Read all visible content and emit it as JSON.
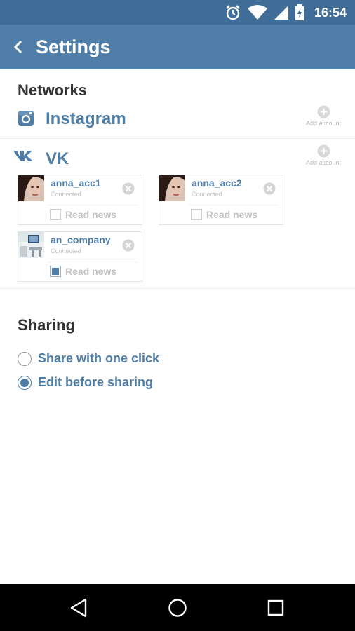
{
  "status_bar": {
    "time": "16:54",
    "icons": [
      "alarm-icon",
      "wifi-icon",
      "signal-icon",
      "battery-icon"
    ]
  },
  "app_bar": {
    "title": "Settings",
    "back_icon": "chevron-left-icon"
  },
  "networks": {
    "title": "Networks",
    "items": [
      {
        "name": "Instagram",
        "icon": "instagram-icon",
        "add_label": "Add account"
      },
      {
        "name": "VK",
        "icon": "vk-icon",
        "add_label": "Add account"
      }
    ],
    "accounts": [
      {
        "name": "anna_acc1",
        "status": "Connected",
        "read_news": "Read news",
        "read_news_checked": false
      },
      {
        "name": "anna_acc2",
        "status": "Connected",
        "read_news": "Read news",
        "read_news_checked": false
      },
      {
        "name": "an_company",
        "status": "Connected",
        "read_news": "Read news",
        "read_news_checked": true
      }
    ]
  },
  "sharing": {
    "title": "Sharing",
    "options": [
      {
        "label": "Share with one click",
        "selected": false
      },
      {
        "label": "Edit before sharing",
        "selected": true
      }
    ]
  },
  "colors": {
    "status_bar": "#3f6d97",
    "app_bar": "#4f7ea8",
    "accent": "#4f7ea8",
    "nav_bar": "#000000"
  }
}
